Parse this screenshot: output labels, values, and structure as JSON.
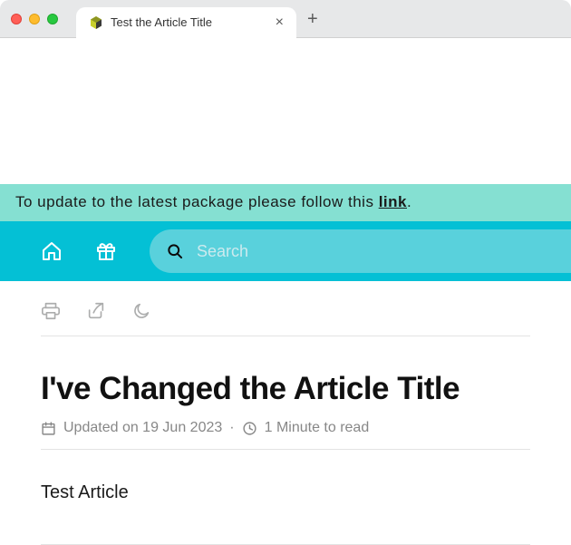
{
  "browser": {
    "tab_title": "Test the Article Title",
    "close_glyph": "×",
    "new_tab_glyph": "+"
  },
  "banner": {
    "text_before": "To update to the latest package please follow this ",
    "link_label": "link",
    "text_after": "."
  },
  "search": {
    "placeholder": "Search"
  },
  "article": {
    "title": "I've Changed the Article Title",
    "updated_label": "Updated on 19 Jun 2023",
    "read_time_label": "1 Minute to read",
    "separator": "·",
    "body": "Test Article"
  }
}
